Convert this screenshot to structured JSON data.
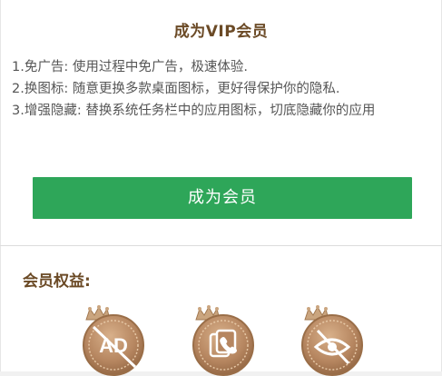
{
  "vip": {
    "title": "成为VIP会员",
    "features": [
      "1.免广告: 使用过程中免广告，极速体验.",
      "2.换图标: 随意更换多款桌面图标，更好得保护你的隐私.",
      "3.增强隐藏: 替换系统任务栏中的应用图标，切底隐藏你的应用"
    ],
    "button_label": "成为会员"
  },
  "benefits": {
    "heading": "会员权益:",
    "icons": [
      {
        "name": "no-ads-badge-icon",
        "text": "AD"
      },
      {
        "name": "change-icon-badge-icon"
      },
      {
        "name": "hide-eye-badge-icon"
      }
    ]
  },
  "colors": {
    "accent_green": "#2ea659",
    "title_brown": "#6b4a26",
    "badge_bronze": "#b88a63"
  }
}
